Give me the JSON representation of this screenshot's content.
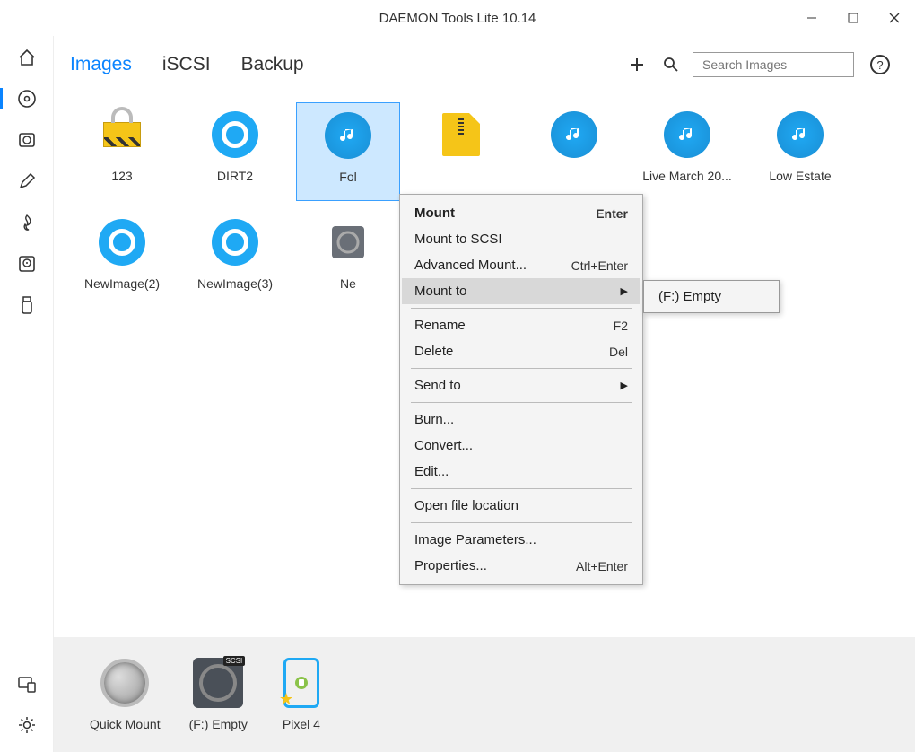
{
  "window": {
    "title": "DAEMON Tools Lite  10.14"
  },
  "sidebar": {
    "items": [
      {
        "name": "home"
      },
      {
        "name": "disc",
        "active": true
      },
      {
        "name": "drive"
      },
      {
        "name": "edit"
      },
      {
        "name": "burn"
      },
      {
        "name": "hdd"
      },
      {
        "name": "usb"
      }
    ]
  },
  "tabs": [
    {
      "label": "Images",
      "active": true
    },
    {
      "label": "iSCSI",
      "active": false
    },
    {
      "label": "Backup",
      "active": false
    }
  ],
  "search": {
    "placeholder": "Search Images"
  },
  "items": [
    {
      "label": "123",
      "icon": "lock"
    },
    {
      "label": "DIRT2",
      "icon": "target"
    },
    {
      "label": "Fol",
      "icon": "music",
      "selected": true
    },
    {
      "label": "",
      "icon": "zip"
    },
    {
      "label": "",
      "icon": "music"
    },
    {
      "label": "Live March 20...",
      "icon": "music"
    },
    {
      "label": "Low Estate",
      "icon": "music"
    },
    {
      "label": "NewImage(2)",
      "icon": "target"
    },
    {
      "label": "NewImage(3)",
      "icon": "target"
    },
    {
      "label": "Ne",
      "icon": "new"
    },
    {
      "label": "...",
      "icon": "blank"
    }
  ],
  "context_menu": {
    "groups": [
      [
        {
          "label": "Mount",
          "shortcut": "Enter",
          "bold": true
        },
        {
          "label": "Mount to SCSI"
        },
        {
          "label": "Advanced Mount...",
          "shortcut": "Ctrl+Enter"
        },
        {
          "label": "Mount to",
          "submenu": true,
          "highlighted": true
        }
      ],
      [
        {
          "label": "Rename",
          "shortcut": "F2"
        },
        {
          "label": "Delete",
          "shortcut": "Del"
        }
      ],
      [
        {
          "label": "Send to",
          "submenu": true
        }
      ],
      [
        {
          "label": "Burn..."
        },
        {
          "label": "Convert..."
        },
        {
          "label": "Edit..."
        }
      ],
      [
        {
          "label": "Open file location"
        }
      ],
      [
        {
          "label": "Image Parameters..."
        },
        {
          "label": "Properties...",
          "shortcut": "Alt+Enter"
        }
      ]
    ]
  },
  "submenu": {
    "items": [
      {
        "label": "(F:) Empty"
      }
    ]
  },
  "devices": [
    {
      "label": "Quick Mount",
      "icon": "quick"
    },
    {
      "label": "(F:) Empty",
      "icon": "scsi",
      "badge": "SCSI"
    },
    {
      "label": "Pixel 4",
      "icon": "phone"
    }
  ]
}
